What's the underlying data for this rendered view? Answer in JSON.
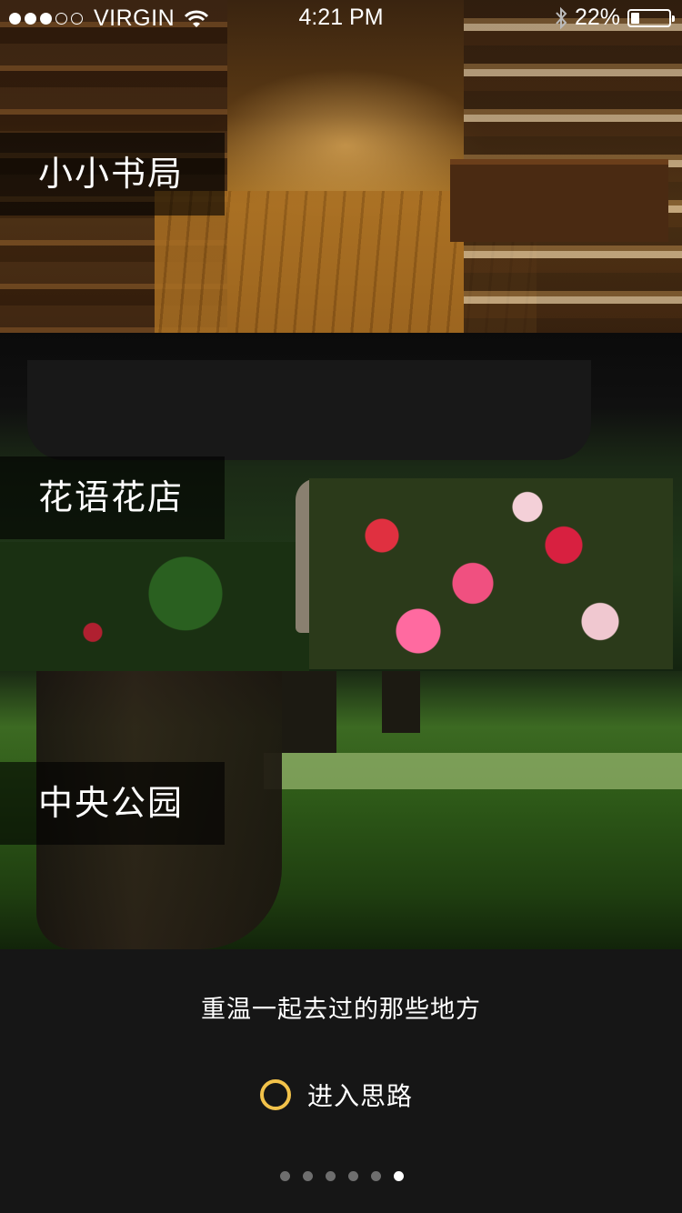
{
  "status_bar": {
    "carrier": "VIRGIN",
    "time": "4:21 PM",
    "battery": "22%",
    "signal_dots_filled": 3,
    "signal_dots_total": 5,
    "battery_level": 0.22
  },
  "places": [
    {
      "label": "小小书局",
      "image": "bookstore-photo"
    },
    {
      "label": "花语花店",
      "image": "flower-shop-photo"
    },
    {
      "label": "中央公园",
      "image": "central-park-photo"
    }
  ],
  "footer": {
    "tagline": "重温一起去过的那些地方",
    "enter_label": "进入思路",
    "enter_icon": "ring-icon",
    "accent_color": "#f2c24a"
  },
  "pager": {
    "count": 6,
    "active_index": 5
  }
}
